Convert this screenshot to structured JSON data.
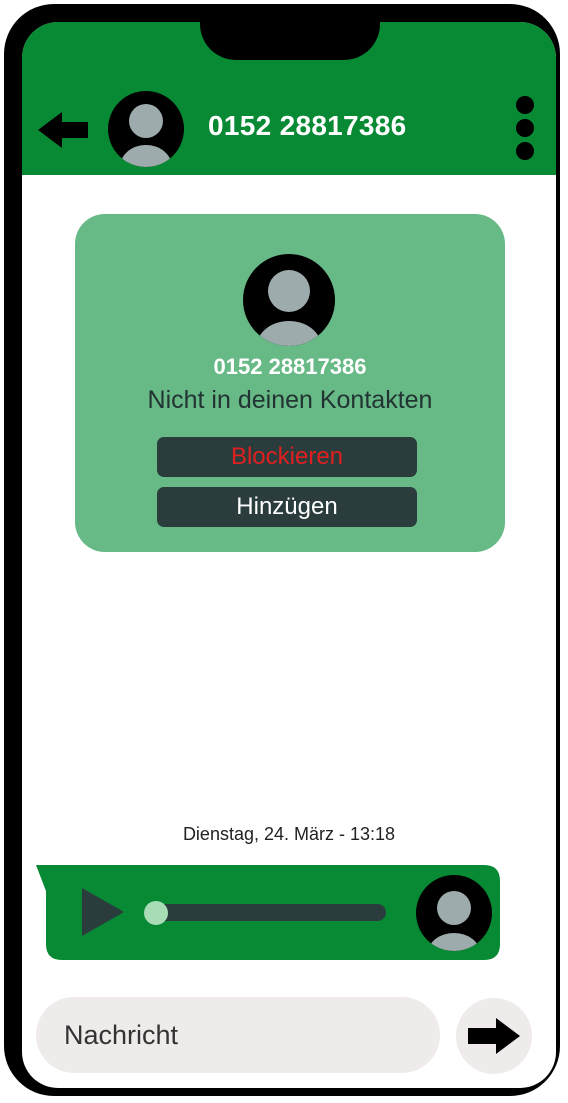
{
  "header": {
    "title": "0152 28817386",
    "background_color": "#078a33",
    "back_icon": "arrow-left-icon",
    "menu_icon": "more-vertical-icon",
    "avatar_icon": "user-avatar-icon"
  },
  "contact_card": {
    "number": "0152 28817386",
    "subtitle": "Nicht in deinen Kontakten",
    "block_label": "Blockieren",
    "add_label": "Hinzügen",
    "card_color": "#67b985",
    "block_color": "#e02020"
  },
  "conversation": {
    "date_label": "Dienstag, 24. März - 13:18",
    "voice_message": {
      "play_icon": "play-icon",
      "progress": 0.0,
      "bubble_color": "#078a33"
    }
  },
  "composer": {
    "placeholder": "Nachricht",
    "send_icon": "arrow-right-icon"
  }
}
